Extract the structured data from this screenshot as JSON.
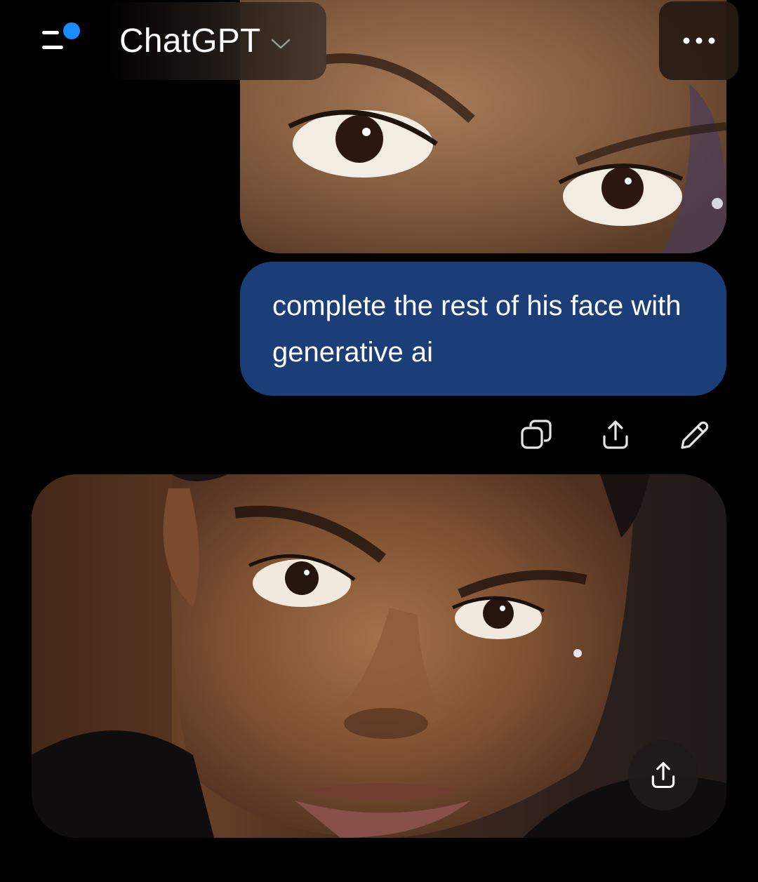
{
  "header": {
    "title": "ChatGPT",
    "menu_icon": "menu-lines-icon",
    "new_indicator_color": "#1a8cff",
    "chevron_icon": "chevron-down-icon",
    "more_icon": "ellipsis-icon"
  },
  "conversation": {
    "user_message": {
      "image_alt": "Cropped photo of eyes",
      "text": "complete the rest of his face with generative ai",
      "bubble_color": "#1b3e78",
      "actions": [
        "copy-icon",
        "share-icon",
        "edit-icon"
      ]
    },
    "assistant_message": {
      "image_alt": "Generated portrait",
      "share_icon": "share-icon"
    }
  }
}
